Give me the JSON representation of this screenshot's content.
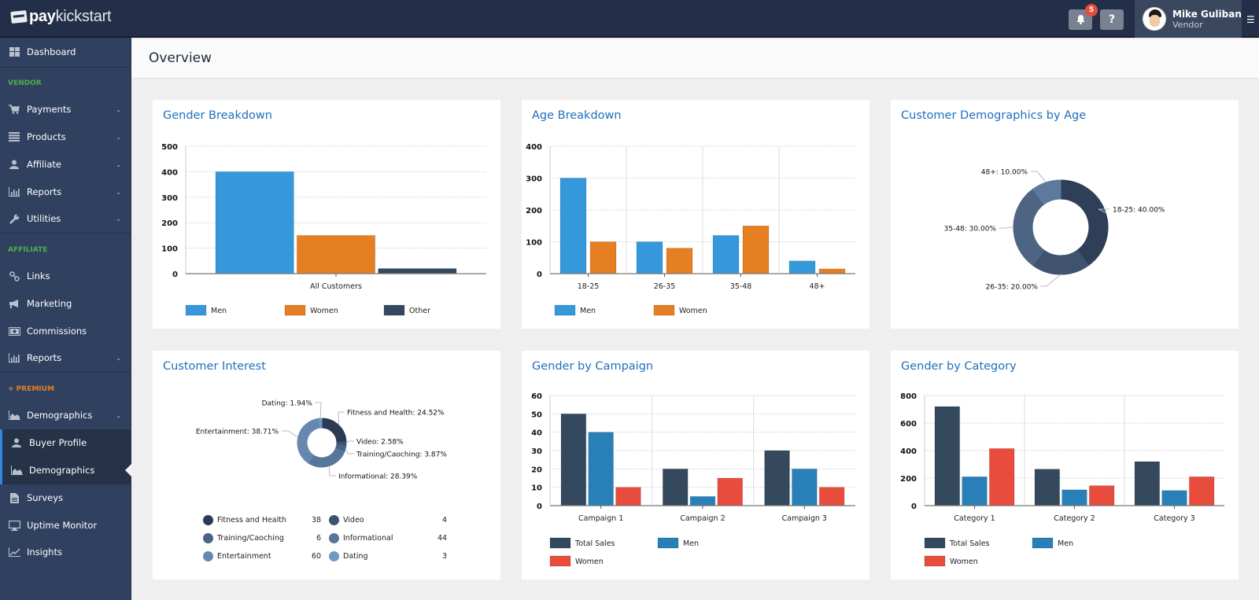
{
  "app": {
    "brand_bold": "pay",
    "brand_light": "kickstart"
  },
  "header": {
    "notifications_count": "5",
    "help_label": "?",
    "user_name": "Mike Guliban",
    "user_role": "Vendor",
    "menu_icon": "☰"
  },
  "sidebar": {
    "dashboard": "Dashboard",
    "sections": {
      "vendor": "VENDOR",
      "affiliate": "AFFILIATE",
      "premium": "+ PREMIUM"
    },
    "vendor_items": [
      {
        "label": "Payments",
        "icon": "cart-icon"
      },
      {
        "label": "Products",
        "icon": "list-icon"
      },
      {
        "label": "Affiliate",
        "icon": "user-icon"
      },
      {
        "label": "Reports",
        "icon": "bar-chart-icon"
      },
      {
        "label": "Utilities",
        "icon": "wrench-icon"
      }
    ],
    "affiliate_items": [
      {
        "label": "Links",
        "icon": "link-icon"
      },
      {
        "label": "Marketing",
        "icon": "megaphone-icon"
      },
      {
        "label": "Commissions",
        "icon": "money-icon"
      },
      {
        "label": "Reports",
        "icon": "bar-chart-icon"
      }
    ],
    "premium_items": [
      {
        "label": "Demographics",
        "icon": "area-chart-icon"
      },
      {
        "label": "Buyer Profile",
        "icon": "user-icon"
      },
      {
        "label": "Demographics",
        "icon": "area-chart-icon"
      },
      {
        "label": "Surveys",
        "icon": "document-icon"
      },
      {
        "label": "Uptime Monitor",
        "icon": "monitor-icon"
      },
      {
        "label": "Insights",
        "icon": "line-chart-icon"
      }
    ]
  },
  "page": {
    "title": "Overview"
  },
  "colors": {
    "men": "#3498db",
    "women_orange": "#e67e22",
    "other": "#34495e",
    "total": "#34495e",
    "men_dark": "#2980b9",
    "women_red": "#e74c3c"
  },
  "chart_data": [
    {
      "type": "bar",
      "title": "Gender Breakdown",
      "categories": [
        "All Customers"
      ],
      "series": [
        {
          "name": "Men",
          "values": [
            400
          ]
        },
        {
          "name": "Women",
          "values": [
            150
          ]
        },
        {
          "name": "Other",
          "values": [
            20
          ]
        }
      ],
      "ylim": [
        0,
        500
      ],
      "yticks": [
        0,
        100,
        200,
        300,
        400,
        500
      ],
      "grid": true,
      "legend": "bottom"
    },
    {
      "type": "bar",
      "title": "Age Breakdown",
      "categories": [
        "18-25",
        "26-35",
        "35-48",
        "48+"
      ],
      "series": [
        {
          "name": "Men",
          "values": [
            300,
            100,
            120,
            40
          ]
        },
        {
          "name": "Women",
          "values": [
            100,
            80,
            150,
            15
          ]
        }
      ],
      "ylim": [
        0,
        400
      ],
      "yticks": [
        0,
        100,
        200,
        300,
        400
      ],
      "grid": true,
      "legend": "bottom"
    },
    {
      "type": "pie",
      "title": "Customer Demographics by Age",
      "slices": [
        {
          "label": "18-25",
          "value": 40,
          "text": "18-25: 40.00%",
          "color": "#2f3f58"
        },
        {
          "label": "26-35",
          "value": 20,
          "text": "26-35: 20.00%",
          "color": "#3f536f"
        },
        {
          "label": "35-48",
          "value": 30,
          "text": "35-48: 30.00%",
          "color": "#4d6582"
        },
        {
          "label": "48+",
          "value": 10,
          "text": "48+: 10.00%",
          "color": "#5c7a9c"
        }
      ],
      "donut": true
    },
    {
      "type": "pie",
      "title": "Customer Interest",
      "slices": [
        {
          "label": "Fitness and Health",
          "value": 38,
          "text": "Fitness and Health: 24.52%",
          "color": "#2c3b55"
        },
        {
          "label": "Video",
          "value": 4,
          "text": "Video: 2.58%",
          "color": "#3e5270"
        },
        {
          "label": "Training/Caoching",
          "value": 6,
          "text": "Training/Caoching: 3.87%",
          "color": "#4a6283"
        },
        {
          "label": "Informational",
          "value": 44,
          "text": "Informational: 28.39%",
          "color": "#56769a"
        },
        {
          "label": "Entertainment",
          "value": 60,
          "text": "Entertainment: 38.71%",
          "color": "#6488b0"
        },
        {
          "label": "Dating",
          "value": 3,
          "text": "Dating: 1.94%",
          "color": "#6f98c6"
        }
      ],
      "donut": true,
      "legend": "bottom-table"
    },
    {
      "type": "bar",
      "title": "Gender by Campaign",
      "categories": [
        "Campaign 1",
        "Campaign 2",
        "Campaign 3"
      ],
      "series": [
        {
          "name": "Total Sales",
          "values": [
            50,
            20,
            30
          ]
        },
        {
          "name": "Men",
          "values": [
            40,
            5,
            20
          ]
        },
        {
          "name": "Women",
          "values": [
            10,
            15,
            10
          ]
        }
      ],
      "ylim": [
        0,
        60
      ],
      "yticks": [
        0,
        10,
        20,
        30,
        40,
        50,
        60
      ],
      "grid": true,
      "legend": "bottom"
    },
    {
      "type": "bar",
      "title": "Gender by Category",
      "categories": [
        "Category 1",
        "Category 2",
        "Category 3"
      ],
      "series": [
        {
          "name": "Total Sales",
          "values": [
            720,
            265,
            320
          ]
        },
        {
          "name": "Men",
          "values": [
            210,
            115,
            110
          ]
        },
        {
          "name": "Women",
          "values": [
            415,
            145,
            210
          ]
        }
      ],
      "ylim": [
        0,
        800
      ],
      "yticks": [
        0,
        200,
        400,
        600,
        800
      ],
      "grid": true,
      "legend": "bottom"
    }
  ]
}
